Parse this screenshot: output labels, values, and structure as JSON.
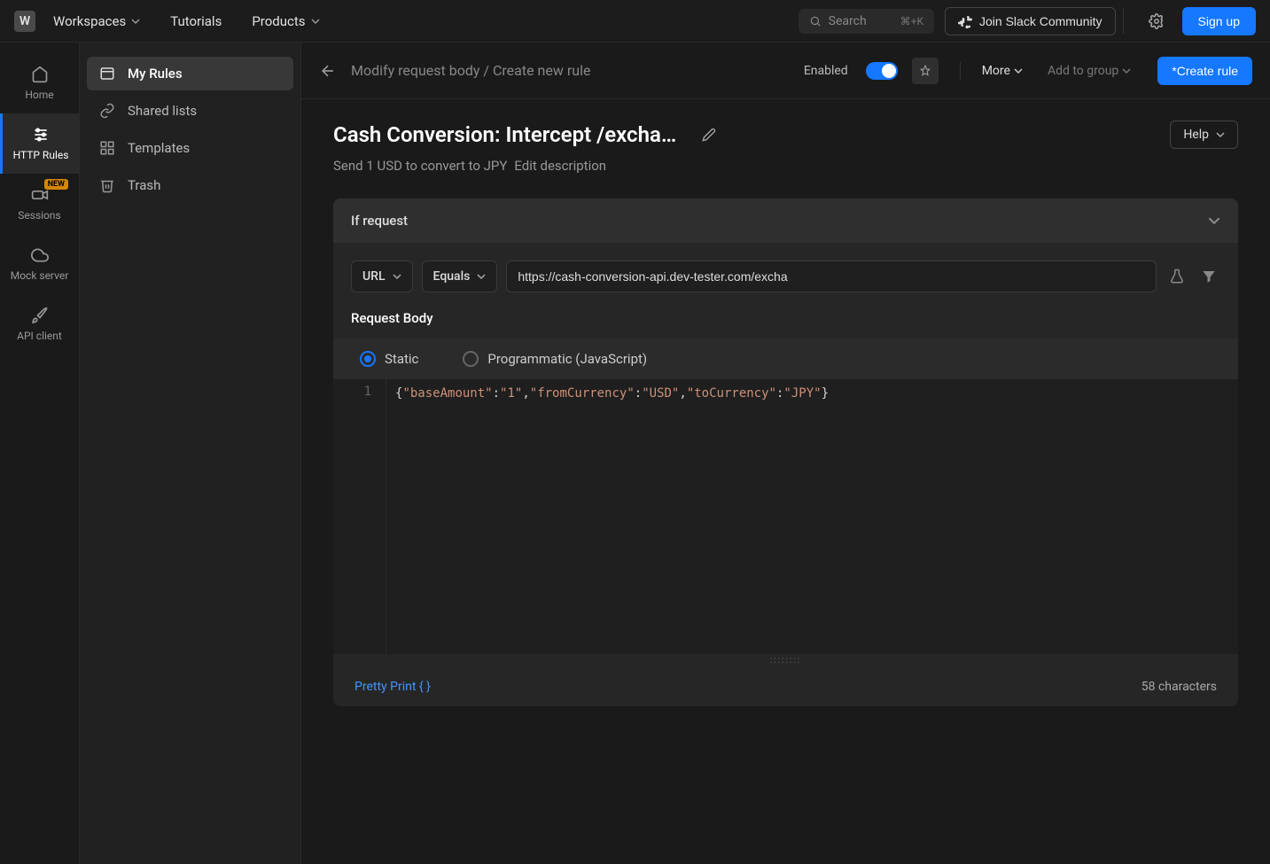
{
  "topbar": {
    "workspace_letter": "W",
    "workspaces": "Workspaces",
    "tutorials": "Tutorials",
    "products": "Products",
    "search_placeholder": "Search",
    "search_kbd": "⌘+K",
    "slack": "Join Slack Community",
    "signup": "Sign up"
  },
  "rail": {
    "home": "Home",
    "http_rules": "HTTP Rules",
    "sessions": "Sessions",
    "sessions_badge": "NEW",
    "mock_server": "Mock server",
    "api_client": "API client"
  },
  "sidebar": {
    "my_rules": "My Rules",
    "shared_lists": "Shared lists",
    "templates": "Templates",
    "trash": "Trash"
  },
  "header": {
    "breadcrumb": "Modify request body / Create new rule",
    "enabled": "Enabled",
    "more": "More",
    "add_to_group": "Add to group",
    "create": "*Create rule"
  },
  "rule": {
    "title": "Cash Conversion: Intercept /exchan…",
    "description": "Send 1 USD to convert to JPY",
    "edit_desc": "Edit description",
    "help": "Help"
  },
  "card": {
    "if_request": "If request",
    "url_label": "URL",
    "equals_label": "Equals",
    "url_value": "https://cash-conversion-api.dev-tester.com/excha",
    "request_body": "Request Body",
    "static": "Static",
    "programmatic": "Programmatic (JavaScript)",
    "line_no": "1",
    "code": "{\"baseAmount\":\"1\",\"fromCurrency\":\"USD\",\"toCurrency\":\"JPY\"}",
    "pretty": "Pretty Print { }",
    "char_count": "58 characters"
  }
}
